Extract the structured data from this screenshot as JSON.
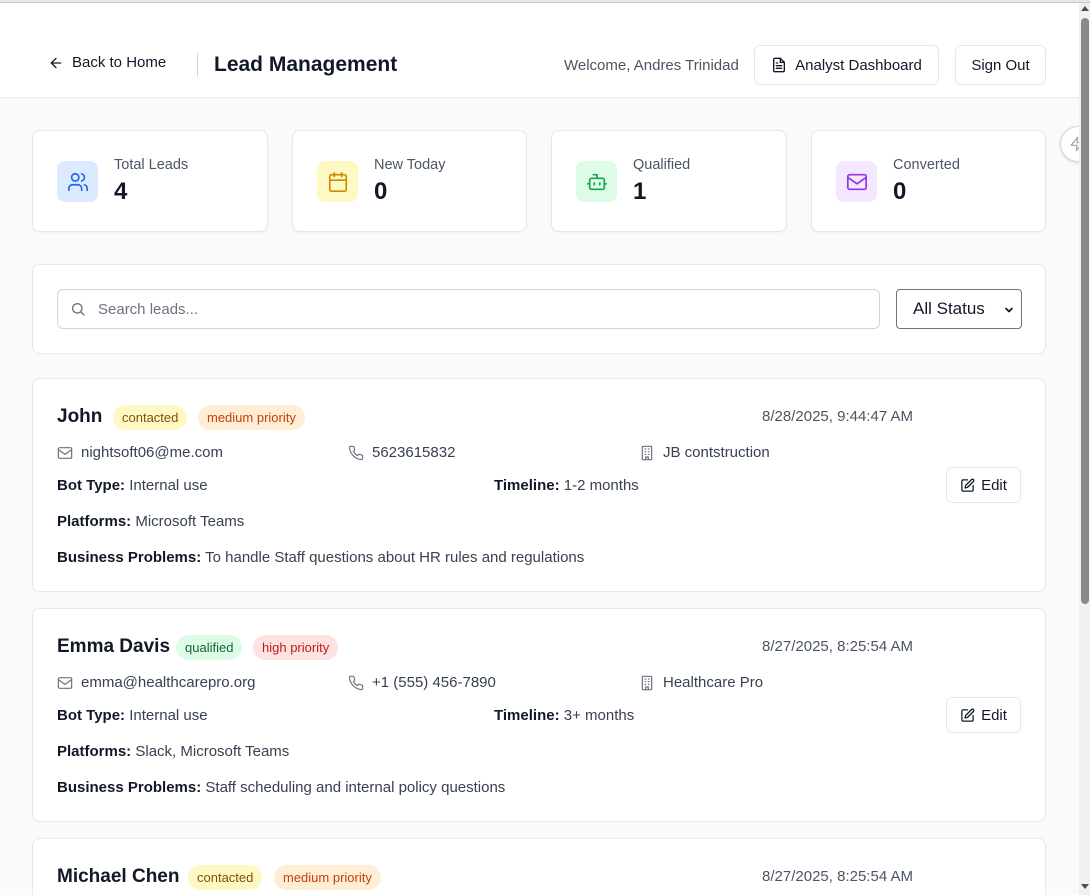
{
  "header": {
    "back_label": "Back to Home",
    "title": "Lead Management",
    "welcome": "Welcome, Andres Trinidad",
    "analyst_button": "Analyst Dashboard",
    "signout_button": "Sign Out"
  },
  "stats": [
    {
      "label": "Total Leads",
      "value": "4",
      "icon": "users-icon",
      "bg": "#dbeafe",
      "color": "#2563eb"
    },
    {
      "label": "New Today",
      "value": "0",
      "icon": "calendar-icon",
      "bg": "#fef9c3",
      "color": "#ca8a04"
    },
    {
      "label": "Qualified",
      "value": "1",
      "icon": "bot-icon",
      "bg": "#dcfce7",
      "color": "#16a34a"
    },
    {
      "label": "Converted",
      "value": "0",
      "icon": "mail-icon",
      "bg": "#f3e8ff",
      "color": "#9333ea"
    }
  ],
  "filters": {
    "search_placeholder": "Search leads...",
    "status_selected": "All Status"
  },
  "field_labels": {
    "bot_type": "Bot Type:",
    "timeline": "Timeline:",
    "platforms": "Platforms:",
    "business_problems": "Business Problems:"
  },
  "edit_label": "Edit",
  "leads": [
    {
      "name": "John",
      "status": "contacted",
      "priority": "medium priority",
      "date": "8/28/2025, 9:44:47 AM",
      "email": "nightsoft06@me.com",
      "phone": "5623615832",
      "company": "JB contstruction",
      "bot_type": "Internal use",
      "timeline": "1-2 months",
      "platforms": "Microsoft Teams",
      "business_problems": "To handle Staff questions about HR rules and regulations"
    },
    {
      "name": "Emma Davis",
      "status": "qualified",
      "priority": "high priority",
      "date": "8/27/2025, 8:25:54 AM",
      "email": "emma@healthcarepro.org",
      "phone": "+1 (555) 456-7890",
      "company": "Healthcare Pro",
      "bot_type": "Internal use",
      "timeline": "3+ months",
      "platforms": "Slack, Microsoft Teams",
      "business_problems": "Staff scheduling and internal policy questions"
    },
    {
      "name": "Michael Chen",
      "status": "contacted",
      "priority": "medium priority",
      "date": "8/27/2025, 8:25:54 AM"
    }
  ]
}
